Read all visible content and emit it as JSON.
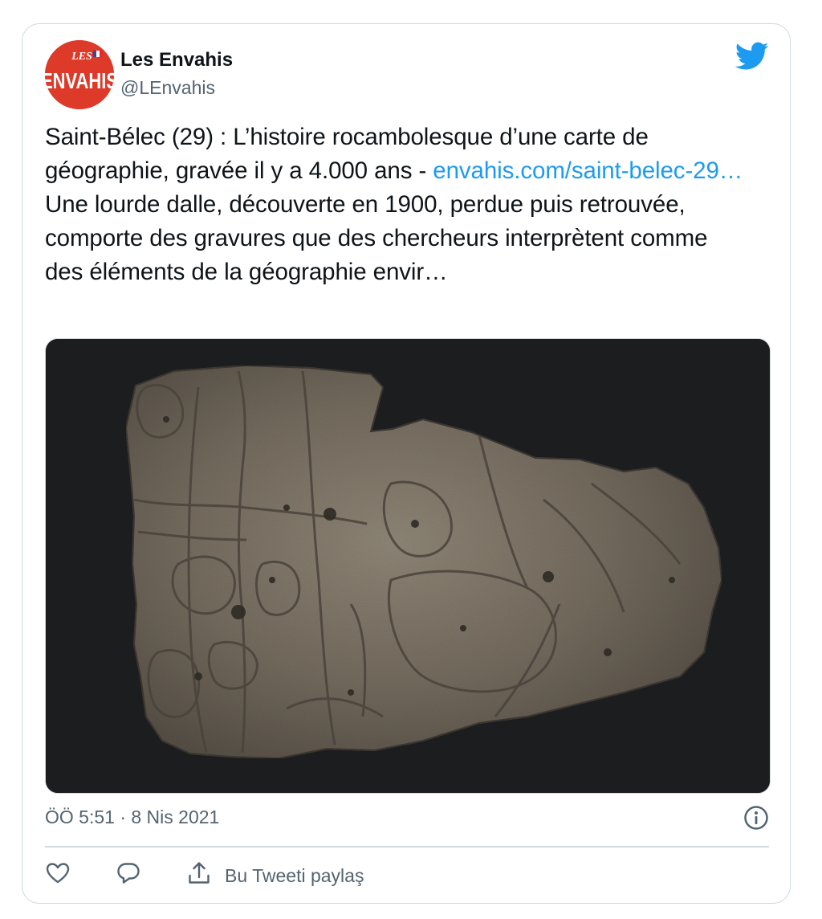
{
  "account": {
    "name": "Les Envahis",
    "handle": "@LEnvahis",
    "avatar_text_top": "LES",
    "avatar_text_main": "ENVAHIS",
    "avatar_color": "#dd3a2a"
  },
  "tweet": {
    "text_part1": "Saint-Bélec (29) : L’histoire rocambolesque d’une carte de géographie, gravée il y a 4.000 ans - ",
    "link_text": "envahis.com/saint-belec-29…",
    "text_part2": "Une lourde dalle, découverte en 1900, perdue puis retrouvée, comporte des gravures que des chercheurs interprètent comme des éléments de la géographie envir…",
    "timestamp": "ÖÖ 5:51 · 8 Nis 2021"
  },
  "media": {
    "description_icon": "engraved-stone-slab-image"
  },
  "actions": {
    "share_label": "Bu Tweeti paylaş"
  },
  "icons": {
    "brand": "twitter-bird-icon",
    "info": "info-icon",
    "like": "heart-icon",
    "reply": "reply-icon",
    "share": "share-icon"
  },
  "colors": {
    "link": "#1d9bf0",
    "secondary_text": "#536471",
    "border": "#cfd9de",
    "twitter_blue": "#1d9bf0"
  }
}
